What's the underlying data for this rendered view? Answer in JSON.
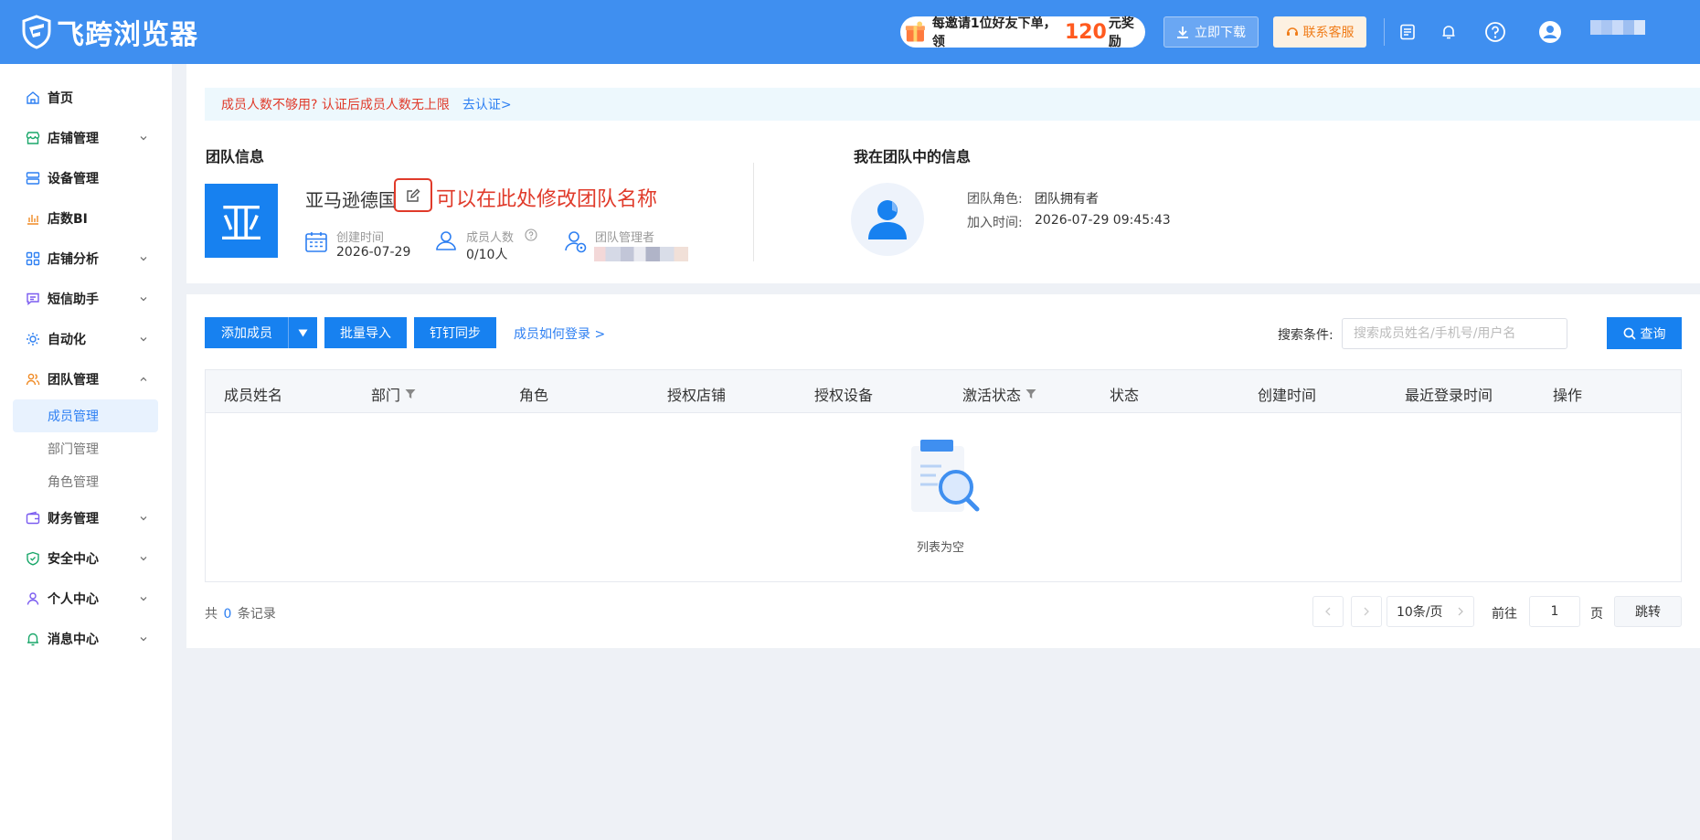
{
  "header": {
    "brand": "飞跨浏览器",
    "promo": {
      "before": "每邀请1位好友下单，领",
      "amount": "120",
      "after": "元奖励"
    },
    "download_label": "立即下载",
    "service_label": "联系客服"
  },
  "sidebar": {
    "items": [
      {
        "label": "首页",
        "icon": "home-icon"
      },
      {
        "label": "店铺管理",
        "icon": "shop-icon"
      },
      {
        "label": "设备管理",
        "icon": "device-icon"
      },
      {
        "label": "店数BI",
        "icon": "chart-bar-icon"
      },
      {
        "label": "店铺分析",
        "icon": "grid-icon"
      },
      {
        "label": "短信助手",
        "icon": "message-icon"
      },
      {
        "label": "自动化",
        "icon": "sun-gear-icon"
      },
      {
        "label": "团队管理",
        "icon": "team-icon"
      },
      {
        "label": "财务管理",
        "icon": "wallet-icon"
      },
      {
        "label": "安全中心",
        "icon": "shield-icon"
      },
      {
        "label": "个人中心",
        "icon": "user-icon"
      },
      {
        "label": "消息中心",
        "icon": "bell-icon"
      }
    ],
    "team_sub": [
      "成员管理",
      "部门管理",
      "角色管理"
    ]
  },
  "notice": {
    "text": "成员人数不够用? 认证后成员人数无上限",
    "link": "去认证>"
  },
  "team_info": {
    "section_title": "团队信息",
    "avatar_char": "亚",
    "name": "亚马逊德国",
    "edit_hint": "可以在此处修改团队名称",
    "created_label": "创建时间",
    "created_value": "2026-07-29",
    "members_label": "成员人数",
    "members_value": "0/10人",
    "manager_label": "团队管理者"
  },
  "my_info": {
    "section_title": "我在团队中的信息",
    "role_label": "团队角色:",
    "role_value": "团队拥有者",
    "joined_label": "加入时间:",
    "joined_value": "2026-07-29 09:45:43"
  },
  "toolbar": {
    "add_member": "添加成员",
    "batch_import": "批量导入",
    "dingtalk_sync": "钉钉同步",
    "how_login": "成员如何登录 >",
    "search_label": "搜索条件:",
    "search_placeholder": "搜索成员姓名/手机号/用户名",
    "query": "查询"
  },
  "table": {
    "columns": [
      "成员姓名",
      "部门",
      "角色",
      "授权店铺",
      "授权设备",
      "激活状态",
      "状态",
      "创建时间",
      "最近登录时间",
      "操作"
    ],
    "empty_text": "列表为空"
  },
  "pagination": {
    "total_prefix": "共",
    "total": "0",
    "total_suffix": "条记录",
    "page_size": "10条/页",
    "goto_label": "前往",
    "page_value": "1",
    "page_unit": "页",
    "jump": "跳转"
  },
  "colors": {
    "header_bg": "#3f8ff0",
    "primary": "#1781f0",
    "danger": "#e03a2a",
    "link": "#2d7ff2"
  }
}
